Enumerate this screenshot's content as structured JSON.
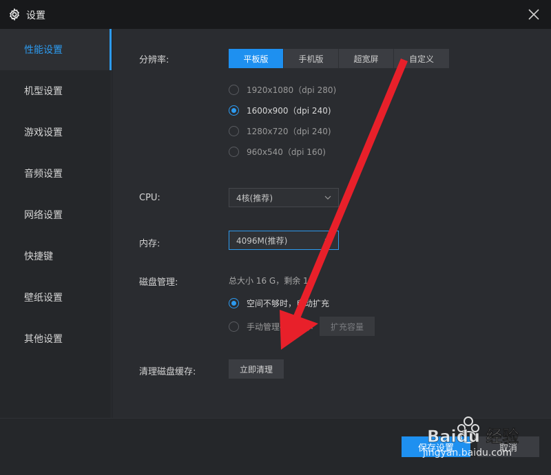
{
  "window": {
    "title": "设置",
    "icon": "gear-icon"
  },
  "sidebar": {
    "items": [
      {
        "label": "性能设置",
        "active": true
      },
      {
        "label": "机型设置"
      },
      {
        "label": "游戏设置"
      },
      {
        "label": "音频设置"
      },
      {
        "label": "网络设置"
      },
      {
        "label": "快捷键"
      },
      {
        "label": "壁纸设置"
      },
      {
        "label": "其他设置"
      }
    ]
  },
  "resolution": {
    "label": "分辨率:",
    "modes": [
      "平板版",
      "手机版",
      "超宽屏",
      "自定义"
    ],
    "active_mode": "平板版",
    "options": [
      {
        "label": "1920x1080（dpi 280)"
      },
      {
        "label": "1600x900（dpi 240)",
        "checked": true
      },
      {
        "label": "1280x720（dpi 240)"
      },
      {
        "label": "960x540（dpi 160)"
      }
    ]
  },
  "cpu": {
    "label": "CPU:",
    "value": "4核(推荐)"
  },
  "memory": {
    "label": "内存:",
    "value": "4096M(推荐)"
  },
  "disk": {
    "label": "磁盘管理:",
    "info": "总大小 16 G，剩余 1",
    "options": [
      {
        "label": "空间不够时，自动扩充",
        "checked": true
      },
      {
        "label": "手动管理磁盘大小"
      }
    ],
    "expand_button": "扩充容量"
  },
  "cache": {
    "label": "清理磁盘缓存:",
    "button": "立即清理"
  },
  "footer": {
    "save": "保存设置",
    "cancel": "取消"
  },
  "watermark": {
    "text": "jingyan.baidu.com",
    "brand": "Baidu 经验"
  },
  "colors": {
    "accent": "#1e90f0",
    "arrow": "#e8202a"
  }
}
